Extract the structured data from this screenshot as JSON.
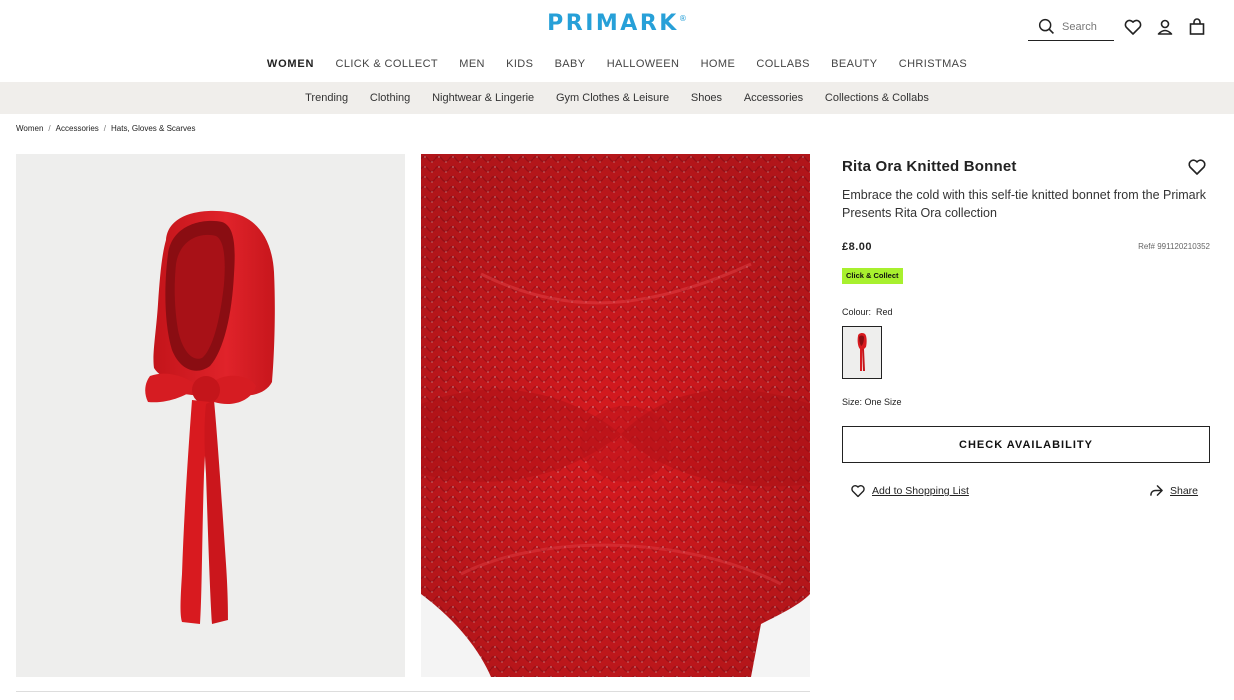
{
  "header": {
    "logo": "PRIMARK",
    "search_placeholder": "Search"
  },
  "main_nav": [
    "WOMEN",
    "CLICK & COLLECT",
    "MEN",
    "KIDS",
    "BABY",
    "HALLOWEEN",
    "HOME",
    "COLLABS",
    "BEAUTY",
    "CHRISTMAS"
  ],
  "sub_nav": [
    "Trending",
    "Clothing",
    "Nightwear & Lingerie",
    "Gym Clothes & Leisure",
    "Shoes",
    "Accessories",
    "Collections & Collabs"
  ],
  "breadcrumb": [
    "Women",
    "Accessories",
    "Hats, Gloves & Scarves"
  ],
  "product": {
    "title": "Rita Ora Knitted Bonnet",
    "description": "Embrace the cold with this self-tie knitted bonnet from the Primark Presents Rita Ora collection",
    "price": "£8.00",
    "ref": "Ref# 991120210352",
    "badge": "Click & Collect",
    "colour_label": "Colour:",
    "colour_value": "Red",
    "size_label": "Size: One Size",
    "cta": "CHECK AVAILABILITY",
    "add_to_list": "Add to Shopping List",
    "share": "Share"
  },
  "colors": {
    "brand": "#27a0d8",
    "badge": "#a8f02e",
    "product_red": "#d81a1f"
  }
}
